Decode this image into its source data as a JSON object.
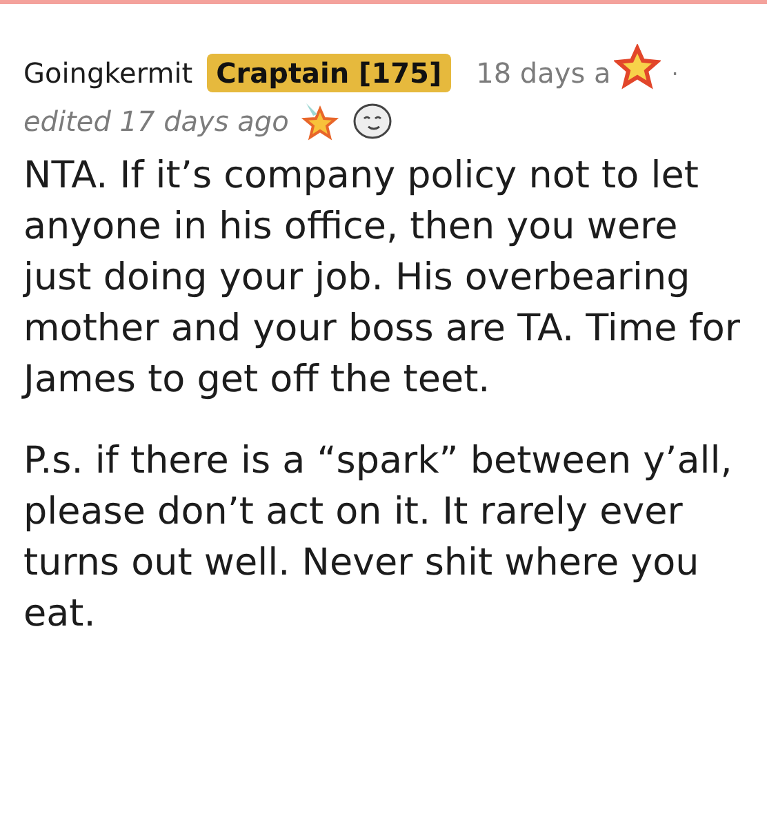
{
  "comment": {
    "author": "Goingkermit",
    "flair": "Craptain [175]",
    "time": "18 days a",
    "separator": "·",
    "edited": "edited 17 days ago",
    "paragraphs": [
      "NTA. If it’s company policy not to let anyone in his office, then you were just doing your job. His overbearing mother and your boss are TA. Time for James to get off the teet.",
      "P.s. if there is a “spark” between y’all, please don’t act on it. It rarely ever turns out well. Never shit where you eat."
    ]
  }
}
